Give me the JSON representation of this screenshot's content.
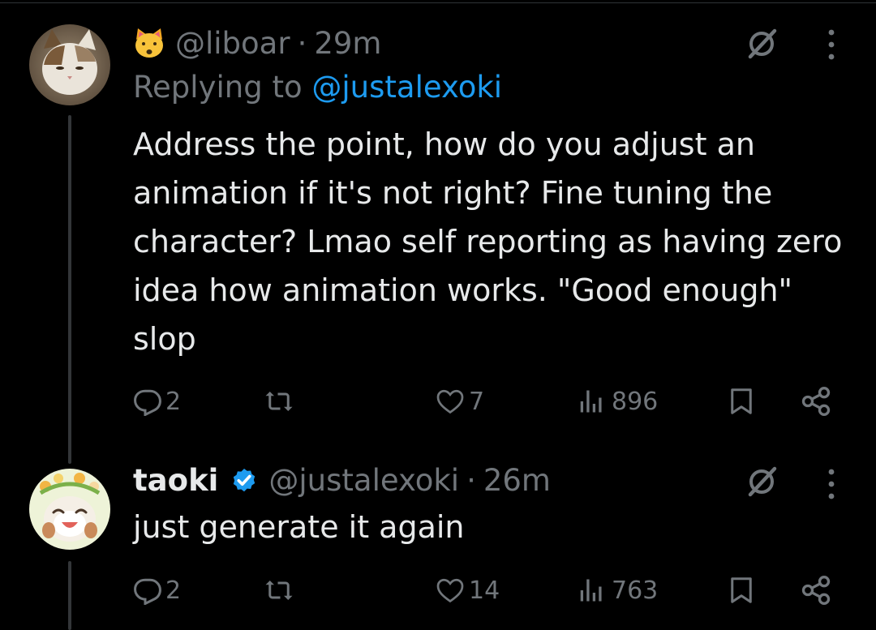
{
  "tweets": [
    {
      "handle": "@liboar",
      "separator": "·",
      "time": "29m",
      "replying_prefix": "Replying to",
      "replying_handle": "@justalexoki",
      "text": "Address the point, how do you adjust an animation if it's not right? Fine tuning the character? Lmao self reporting as having zero idea how animation works. \"Good enough\" slop",
      "replies": "2",
      "likes": "7",
      "views": "896"
    },
    {
      "name": "taoki",
      "handle": "@justalexoki",
      "separator": "·",
      "time": "26m",
      "text": "just generate it again",
      "replies": "2",
      "likes": "14",
      "views": "763"
    }
  ],
  "icons": {
    "header_emoji": "cat-face-emoji",
    "verified": "verified-badge-icon",
    "grok": "grok-icon",
    "more": "more-dots-icon",
    "reply": "reply-icon",
    "repost": "repost-icon",
    "like": "heart-icon",
    "views": "views-icon",
    "bookmark": "bookmark-icon",
    "share": "share-icon"
  },
  "colors": {
    "background": "#000000",
    "text": "#e7e9ea",
    "secondary": "#71767b",
    "accent": "#1d9bf0"
  }
}
